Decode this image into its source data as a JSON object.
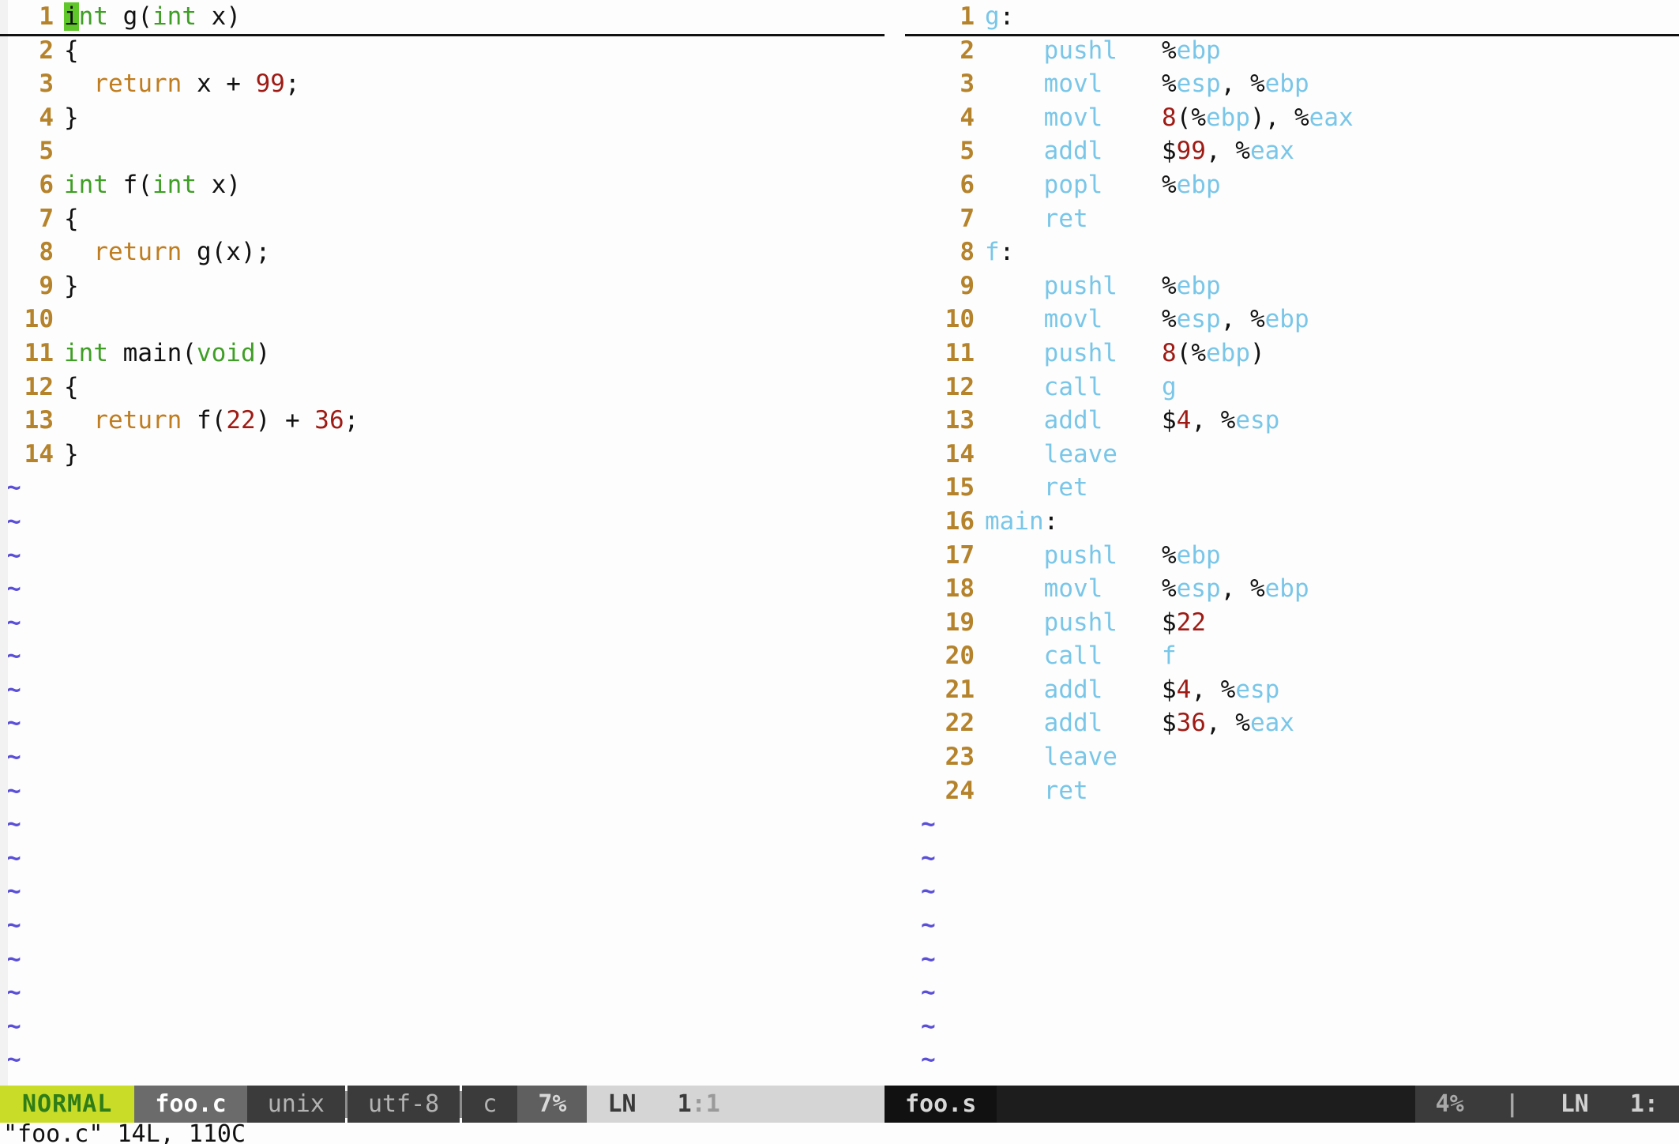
{
  "editor": {
    "mode": "NORMAL",
    "cmdline": "\"foo.c\" 14L, 110C"
  },
  "left_pane": {
    "name": "foo.c",
    "cursor_char": "i",
    "lines": [
      {
        "n": "1",
        "tokens": [
          {
            "t": "int",
            "c": "kw",
            "cursor": true
          },
          {
            "t": " g(",
            "c": "pun"
          },
          {
            "t": "int",
            "c": "kw"
          },
          {
            "t": " x)",
            "c": "pun"
          }
        ]
      },
      {
        "n": "2",
        "tokens": [
          {
            "t": "{",
            "c": "pun"
          }
        ]
      },
      {
        "n": "3",
        "tokens": [
          {
            "t": "  ",
            "c": "pun"
          },
          {
            "t": "return",
            "c": "ret"
          },
          {
            "t": " x + ",
            "c": "pun"
          },
          {
            "t": "99",
            "c": "num"
          },
          {
            "t": ";",
            "c": "pun"
          }
        ]
      },
      {
        "n": "4",
        "tokens": [
          {
            "t": "}",
            "c": "pun"
          }
        ]
      },
      {
        "n": "5",
        "tokens": []
      },
      {
        "n": "6",
        "tokens": [
          {
            "t": "int",
            "c": "kw"
          },
          {
            "t": " f(",
            "c": "pun"
          },
          {
            "t": "int",
            "c": "kw"
          },
          {
            "t": " x)",
            "c": "pun"
          }
        ]
      },
      {
        "n": "7",
        "tokens": [
          {
            "t": "{",
            "c": "pun"
          }
        ]
      },
      {
        "n": "8",
        "tokens": [
          {
            "t": "  ",
            "c": "pun"
          },
          {
            "t": "return",
            "c": "ret"
          },
          {
            "t": " g(x);",
            "c": "pun"
          }
        ]
      },
      {
        "n": "9",
        "tokens": [
          {
            "t": "}",
            "c": "pun"
          }
        ]
      },
      {
        "n": "10",
        "tokens": []
      },
      {
        "n": "11",
        "tokens": [
          {
            "t": "int",
            "c": "kw"
          },
          {
            "t": " main(",
            "c": "pun"
          },
          {
            "t": "void",
            "c": "kw"
          },
          {
            "t": ")",
            "c": "pun"
          }
        ]
      },
      {
        "n": "12",
        "tokens": [
          {
            "t": "{",
            "c": "pun"
          }
        ]
      },
      {
        "n": "13",
        "tokens": [
          {
            "t": "  ",
            "c": "pun"
          },
          {
            "t": "return",
            "c": "ret"
          },
          {
            "t": " f(",
            "c": "pun"
          },
          {
            "t": "22",
            "c": "num"
          },
          {
            "t": ") + ",
            "c": "pun"
          },
          {
            "t": "36",
            "c": "num"
          },
          {
            "t": ";",
            "c": "pun"
          }
        ]
      },
      {
        "n": "14",
        "tokens": [
          {
            "t": "}",
            "c": "pun"
          }
        ]
      }
    ],
    "tilde_count": 18,
    "status": {
      "mode": "NORMAL",
      "file": "foo.c",
      "fileformat": "unix",
      "encoding": "utf-8",
      "filetype": "c",
      "percent": "7%",
      "ln_label": "LN",
      "position": "1:1",
      "position_line": "1",
      "position_col": "1"
    }
  },
  "right_pane": {
    "name": "foo.s",
    "lines": [
      {
        "n": "1",
        "tokens": [
          {
            "t": "g",
            "c": "label"
          },
          {
            "t": ":",
            "c": "sym"
          }
        ]
      },
      {
        "n": "2",
        "tokens": [
          {
            "t": "    ",
            "c": "sym"
          },
          {
            "t": "pushl",
            "c": "asm"
          },
          {
            "t": "   ",
            "c": "sym"
          },
          {
            "t": "%",
            "c": "sym"
          },
          {
            "t": "ebp",
            "c": "reg"
          }
        ]
      },
      {
        "n": "3",
        "tokens": [
          {
            "t": "    ",
            "c": "sym"
          },
          {
            "t": "movl",
            "c": "asm"
          },
          {
            "t": "    ",
            "c": "sym"
          },
          {
            "t": "%",
            "c": "sym"
          },
          {
            "t": "esp",
            "c": "reg"
          },
          {
            "t": ", ",
            "c": "sym"
          },
          {
            "t": "%",
            "c": "sym"
          },
          {
            "t": "ebp",
            "c": "reg"
          }
        ]
      },
      {
        "n": "4",
        "tokens": [
          {
            "t": "    ",
            "c": "sym"
          },
          {
            "t": "movl",
            "c": "asm"
          },
          {
            "t": "    ",
            "c": "sym"
          },
          {
            "t": "8",
            "c": "num"
          },
          {
            "t": "(",
            "c": "sym"
          },
          {
            "t": "%",
            "c": "sym"
          },
          {
            "t": "ebp",
            "c": "reg"
          },
          {
            "t": "), ",
            "c": "sym"
          },
          {
            "t": "%",
            "c": "sym"
          },
          {
            "t": "eax",
            "c": "reg"
          }
        ]
      },
      {
        "n": "5",
        "tokens": [
          {
            "t": "    ",
            "c": "sym"
          },
          {
            "t": "addl",
            "c": "asm"
          },
          {
            "t": "    ",
            "c": "sym"
          },
          {
            "t": "$",
            "c": "sym"
          },
          {
            "t": "99",
            "c": "num"
          },
          {
            "t": ", ",
            "c": "sym"
          },
          {
            "t": "%",
            "c": "sym"
          },
          {
            "t": "eax",
            "c": "reg"
          }
        ]
      },
      {
        "n": "6",
        "tokens": [
          {
            "t": "    ",
            "c": "sym"
          },
          {
            "t": "popl",
            "c": "asm"
          },
          {
            "t": "    ",
            "c": "sym"
          },
          {
            "t": "%",
            "c": "sym"
          },
          {
            "t": "ebp",
            "c": "reg"
          }
        ]
      },
      {
        "n": "7",
        "tokens": [
          {
            "t": "    ",
            "c": "sym"
          },
          {
            "t": "ret",
            "c": "asm"
          }
        ]
      },
      {
        "n": "8",
        "tokens": [
          {
            "t": "f",
            "c": "label"
          },
          {
            "t": ":",
            "c": "sym"
          }
        ]
      },
      {
        "n": "9",
        "tokens": [
          {
            "t": "    ",
            "c": "sym"
          },
          {
            "t": "pushl",
            "c": "asm"
          },
          {
            "t": "   ",
            "c": "sym"
          },
          {
            "t": "%",
            "c": "sym"
          },
          {
            "t": "ebp",
            "c": "reg"
          }
        ]
      },
      {
        "n": "10",
        "tokens": [
          {
            "t": "    ",
            "c": "sym"
          },
          {
            "t": "movl",
            "c": "asm"
          },
          {
            "t": "    ",
            "c": "sym"
          },
          {
            "t": "%",
            "c": "sym"
          },
          {
            "t": "esp",
            "c": "reg"
          },
          {
            "t": ", ",
            "c": "sym"
          },
          {
            "t": "%",
            "c": "sym"
          },
          {
            "t": "ebp",
            "c": "reg"
          }
        ]
      },
      {
        "n": "11",
        "tokens": [
          {
            "t": "    ",
            "c": "sym"
          },
          {
            "t": "pushl",
            "c": "asm"
          },
          {
            "t": "   ",
            "c": "sym"
          },
          {
            "t": "8",
            "c": "num"
          },
          {
            "t": "(",
            "c": "sym"
          },
          {
            "t": "%",
            "c": "sym"
          },
          {
            "t": "ebp",
            "c": "reg"
          },
          {
            "t": ")",
            "c": "sym"
          }
        ]
      },
      {
        "n": "12",
        "tokens": [
          {
            "t": "    ",
            "c": "sym"
          },
          {
            "t": "call",
            "c": "asm"
          },
          {
            "t": "    ",
            "c": "sym"
          },
          {
            "t": "g",
            "c": "label"
          }
        ]
      },
      {
        "n": "13",
        "tokens": [
          {
            "t": "    ",
            "c": "sym"
          },
          {
            "t": "addl",
            "c": "asm"
          },
          {
            "t": "    ",
            "c": "sym"
          },
          {
            "t": "$",
            "c": "sym"
          },
          {
            "t": "4",
            "c": "num"
          },
          {
            "t": ", ",
            "c": "sym"
          },
          {
            "t": "%",
            "c": "sym"
          },
          {
            "t": "esp",
            "c": "reg"
          }
        ]
      },
      {
        "n": "14",
        "tokens": [
          {
            "t": "    ",
            "c": "sym"
          },
          {
            "t": "leave",
            "c": "asm"
          }
        ]
      },
      {
        "n": "15",
        "tokens": [
          {
            "t": "    ",
            "c": "sym"
          },
          {
            "t": "ret",
            "c": "asm"
          }
        ]
      },
      {
        "n": "16",
        "tokens": [
          {
            "t": "main",
            "c": "label"
          },
          {
            "t": ":",
            "c": "sym"
          }
        ]
      },
      {
        "n": "17",
        "tokens": [
          {
            "t": "    ",
            "c": "sym"
          },
          {
            "t": "pushl",
            "c": "asm"
          },
          {
            "t": "   ",
            "c": "sym"
          },
          {
            "t": "%",
            "c": "sym"
          },
          {
            "t": "ebp",
            "c": "reg"
          }
        ]
      },
      {
        "n": "18",
        "tokens": [
          {
            "t": "    ",
            "c": "sym"
          },
          {
            "t": "movl",
            "c": "asm"
          },
          {
            "t": "    ",
            "c": "sym"
          },
          {
            "t": "%",
            "c": "sym"
          },
          {
            "t": "esp",
            "c": "reg"
          },
          {
            "t": ", ",
            "c": "sym"
          },
          {
            "t": "%",
            "c": "sym"
          },
          {
            "t": "ebp",
            "c": "reg"
          }
        ]
      },
      {
        "n": "19",
        "tokens": [
          {
            "t": "    ",
            "c": "sym"
          },
          {
            "t": "pushl",
            "c": "asm"
          },
          {
            "t": "   ",
            "c": "sym"
          },
          {
            "t": "$",
            "c": "sym"
          },
          {
            "t": "22",
            "c": "num"
          }
        ]
      },
      {
        "n": "20",
        "tokens": [
          {
            "t": "    ",
            "c": "sym"
          },
          {
            "t": "call",
            "c": "asm"
          },
          {
            "t": "    ",
            "c": "sym"
          },
          {
            "t": "f",
            "c": "label"
          }
        ]
      },
      {
        "n": "21",
        "tokens": [
          {
            "t": "    ",
            "c": "sym"
          },
          {
            "t": "addl",
            "c": "asm"
          },
          {
            "t": "    ",
            "c": "sym"
          },
          {
            "t": "$",
            "c": "sym"
          },
          {
            "t": "4",
            "c": "num"
          },
          {
            "t": ", ",
            "c": "sym"
          },
          {
            "t": "%",
            "c": "sym"
          },
          {
            "t": "esp",
            "c": "reg"
          }
        ]
      },
      {
        "n": "22",
        "tokens": [
          {
            "t": "    ",
            "c": "sym"
          },
          {
            "t": "addl",
            "c": "asm"
          },
          {
            "t": "    ",
            "c": "sym"
          },
          {
            "t": "$",
            "c": "sym"
          },
          {
            "t": "36",
            "c": "num"
          },
          {
            "t": ", ",
            "c": "sym"
          },
          {
            "t": "%",
            "c": "sym"
          },
          {
            "t": "eax",
            "c": "reg"
          }
        ]
      },
      {
        "n": "23",
        "tokens": [
          {
            "t": "    ",
            "c": "sym"
          },
          {
            "t": "leave",
            "c": "asm"
          }
        ]
      },
      {
        "n": "24",
        "tokens": [
          {
            "t": "    ",
            "c": "sym"
          },
          {
            "t": "ret",
            "c": "asm"
          }
        ]
      }
    ],
    "tilde_count": 8,
    "status": {
      "file": "foo.s",
      "percent": "4%",
      "separator": "|",
      "ln_label": "LN",
      "position": "1:"
    }
  },
  "colors": {
    "keyword": "#3f9e26",
    "number": "#9e1b15",
    "return": "#bf7d20",
    "linenumber": "#b5832b",
    "asm": "#79c6e8",
    "tilde": "#5a4fd6",
    "mode_bg": "#c8dc28",
    "mode_fg": "#2e7d18",
    "background": "#fdfdfd"
  }
}
